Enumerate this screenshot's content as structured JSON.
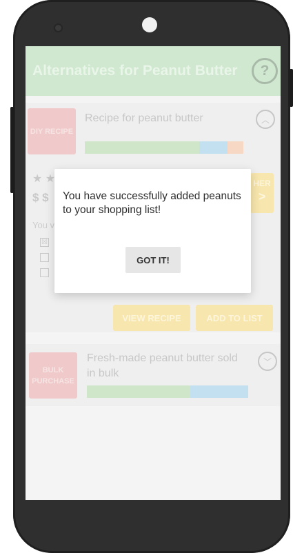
{
  "app": {
    "title": "Alternatives for Peanut Butter",
    "help_icon": "help-circle-icon",
    "colors": {
      "appbar": "#cfe8cf",
      "tag": "#f0caca",
      "action": "#f7e6ad",
      "bar_green": "#cfe6c9",
      "bar_blue": "#c2e0ef",
      "bar_orange": "#f6d8c4"
    }
  },
  "cards": [
    {
      "tag": "DIY RECIPE",
      "description": "Recipe for peanut butter",
      "expanded": true,
      "chevron_icon": "chevron-up-icon",
      "bar": [
        0.72,
        0.18,
        0.1
      ],
      "stars": "★ ★",
      "price": "$ $",
      "you_text": "You v",
      "checklist": [
        "☒",
        "",
        ""
      ],
      "other_label": "HER",
      "other_arrow": ">",
      "view_recipe": "VIEW RECIPE",
      "add_to_list": "ADD TO LIST"
    },
    {
      "tag": "BULK PURCHASE",
      "description": "Fresh-made peanut butter sold in bulk",
      "expanded": false,
      "chevron_icon": "chevron-down-icon",
      "bar": [
        0.64,
        0.36
      ]
    }
  ],
  "dialog": {
    "message": "You have successfully added peanuts to your shopping list!",
    "button": "GOT IT!"
  }
}
